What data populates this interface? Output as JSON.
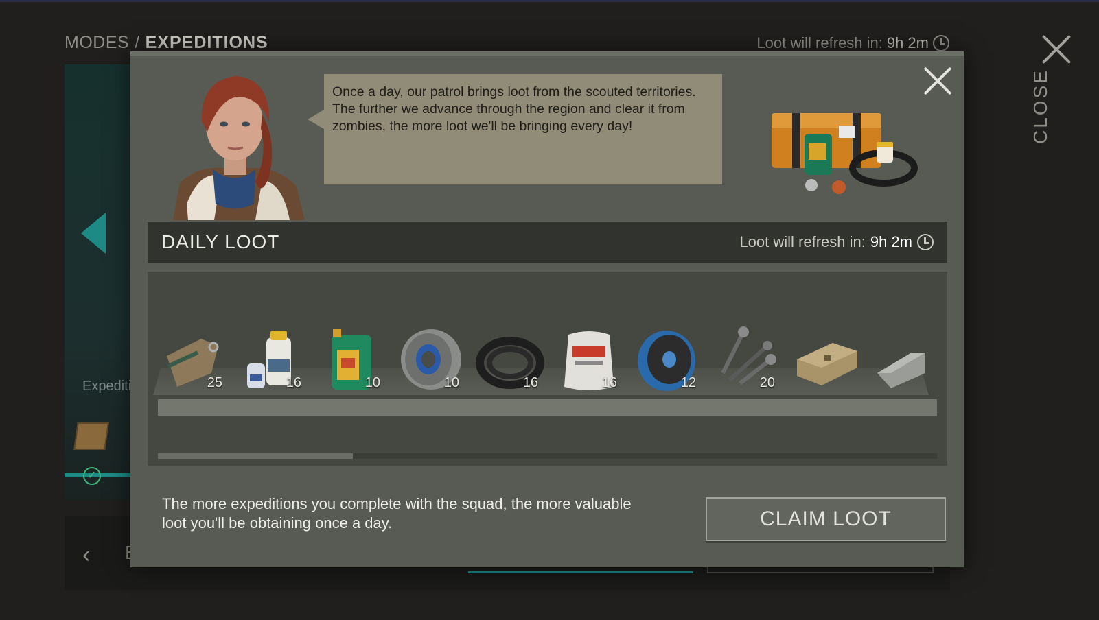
{
  "background": {
    "breadcrumb": {
      "parent": "MODES",
      "separator": "/",
      "current": "EXPEDITIONS"
    },
    "refresh": {
      "label": "Loot will refresh in:",
      "time": "9h 2m"
    },
    "close_label": "CLOSE",
    "expedition_label": "Expediti",
    "back_label": "E"
  },
  "modal": {
    "speech": "Once a day, our patrol brings loot from the scouted territories. The further we advance through the region and clear it from zombies, the more loot we'll be bringing every day!",
    "daily_loot": {
      "title": "DAILY LOOT",
      "refresh_label": "Loot will refresh in:",
      "refresh_time": "9h 2m"
    },
    "items": [
      {
        "icon": "tags-icon",
        "count": "25"
      },
      {
        "icon": "resin-bottles-icon",
        "count": "16"
      },
      {
        "icon": "motor-oil-icon",
        "count": "10"
      },
      {
        "icon": "pulley-icon",
        "count": "10"
      },
      {
        "icon": "rubber-hose-icon",
        "count": "16"
      },
      {
        "icon": "asbestos-bag-icon",
        "count": "16"
      },
      {
        "icon": "wire-spool-icon",
        "count": "12"
      },
      {
        "icon": "screws-icon",
        "count": "20"
      },
      {
        "icon": "ammo-crate-icon",
        "count": ""
      },
      {
        "icon": "metal-ingot-icon",
        "count": ""
      }
    ],
    "scroll_progress": 0.25,
    "footer_text": "The more expeditions you complete with the squad, the more valuable loot you'll be obtaining once a day.",
    "claim_button": "CLAIM LOOT"
  }
}
